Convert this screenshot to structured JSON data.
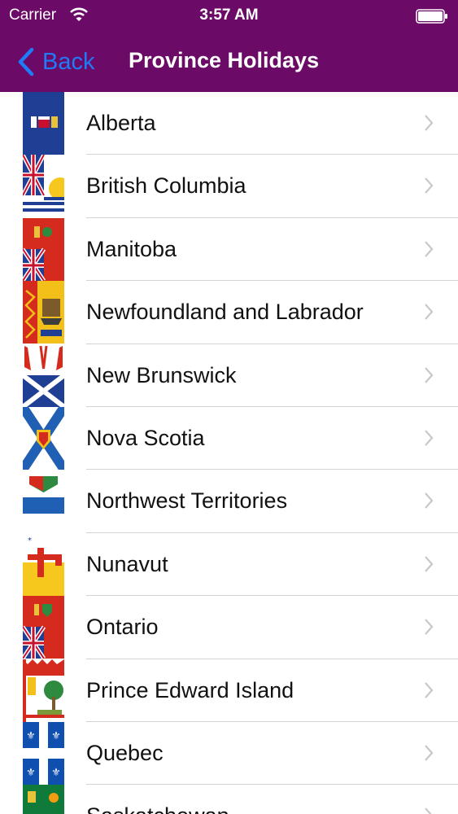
{
  "status": {
    "carrier": "Carrier",
    "time": "3:57 AM"
  },
  "nav": {
    "back_label": "Back",
    "title": "Province Holidays"
  },
  "provinces": [
    {
      "name": "Alberta"
    },
    {
      "name": "British Columbia"
    },
    {
      "name": "Manitoba"
    },
    {
      "name": "Newfoundland and Labrador"
    },
    {
      "name": "New Brunswick"
    },
    {
      "name": "Nova Scotia"
    },
    {
      "name": "Northwest Territories"
    },
    {
      "name": "Nunavut"
    },
    {
      "name": "Ontario"
    },
    {
      "name": "Prince Edward Island"
    },
    {
      "name": "Quebec"
    },
    {
      "name": "Saskatchewan"
    }
  ],
  "colors": {
    "header": "#6c0a67",
    "back_tint": "#1f7bf6",
    "separator": "#d4d4d4"
  }
}
